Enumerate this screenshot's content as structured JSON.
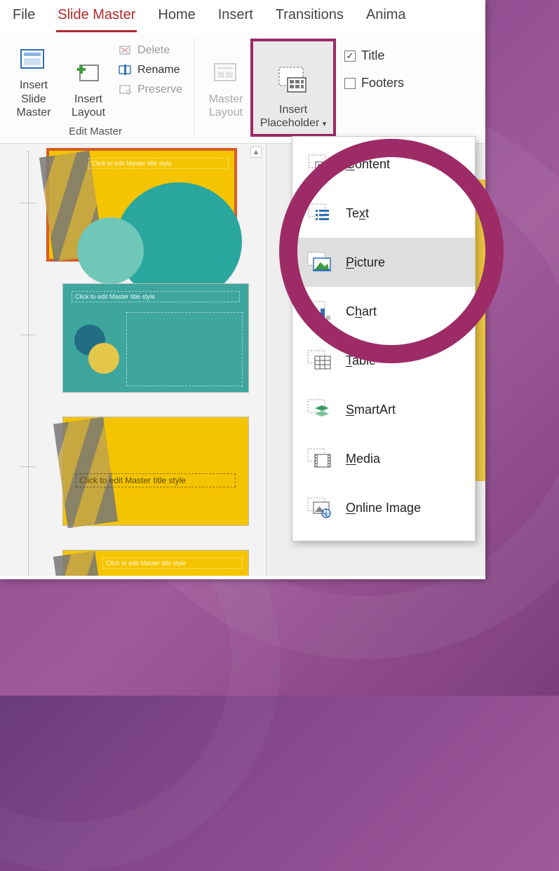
{
  "tabs": {
    "file": "File",
    "slide_master": "Slide Master",
    "home": "Home",
    "insert": "Insert",
    "transitions": "Transitions",
    "animations": "Anima"
  },
  "ribbon": {
    "insert_slide_master": "Insert Slide Master",
    "insert_layout": "Insert Layout",
    "delete": "Delete",
    "rename": "Rename",
    "preserve": "Preserve",
    "group_edit_master": "Edit Master",
    "master_layout": "Master Layout",
    "insert_placeholder": "Insert Placeholder",
    "title_chk": "Title",
    "footers_chk": "Footers"
  },
  "dropdown": {
    "content": "Content",
    "text": "Text",
    "picture": "Picture",
    "chart": "Chart",
    "table": "Table",
    "smartart": "SmartArt",
    "media": "Media",
    "online_image": "Online Image"
  },
  "thumbs": {
    "master_title": "Click to edit Master title style",
    "layout_title1": "Click to edit Master title style",
    "layout_title2": "Click to edit Master title style",
    "layout_title3": "Click to edit Master title style"
  }
}
